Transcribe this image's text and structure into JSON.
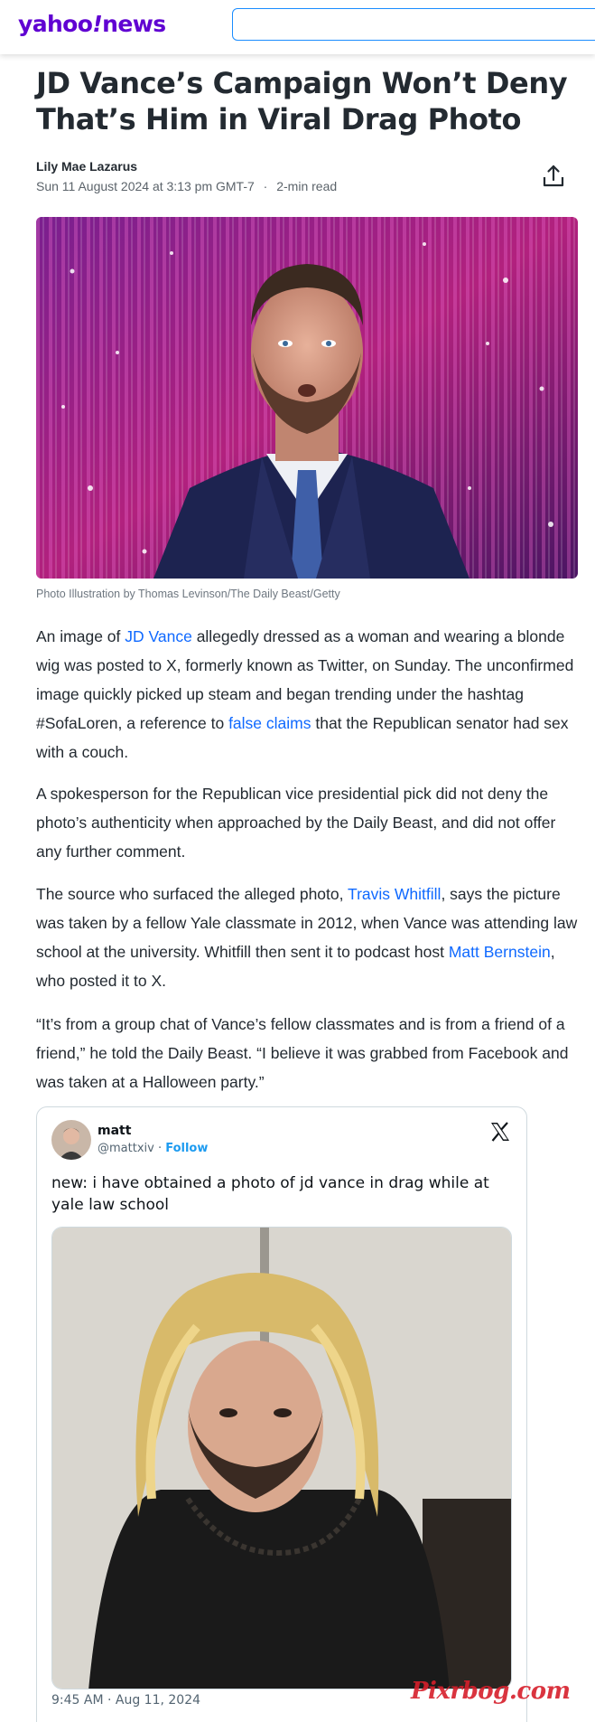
{
  "brand": {
    "logo_main": "yahoo",
    "logo_bang": "!",
    "logo_section": "news",
    "accent": "#6001d2",
    "link_color": "#0f69ff"
  },
  "search": {
    "placeholder": ""
  },
  "article": {
    "headline": "JD Vance’s Campaign Won’t Deny That’s Him in Viral Drag Photo",
    "author": "Lily Mae Lazarus",
    "date": "Sun 11 August 2024 at 3:13 pm GMT-7",
    "separator": "·",
    "read_time": "2-min read",
    "hero_caption": "Photo Illustration by Thomas Levinson/The Daily Beast/Getty",
    "p1": {
      "t1": "An image of ",
      "link1": "JD Vance",
      "t2": " allegedly dressed as a woman and wearing a blonde wig was posted to X, formerly known as Twitter, on Sunday. The unconfirmed image quickly picked up steam and began trending under the hashtag #SofaLoren, a reference to ",
      "link2": "false claims",
      "t3": " that the Republican senator had sex with a couch."
    },
    "p2": "A spokesperson for the Republican vice presidential pick did not deny the photo’s authenticity when approached by the Daily Beast, and did not offer any further comment.",
    "p3": {
      "t1": "The source who surfaced the alleged photo, ",
      "link1": "Travis Whitfill",
      "t2": ", says the picture was taken by a fellow Yale classmate in 2012, when Vance was attending law school at the university. Whitfill then sent it to podcast host ",
      "link2": "Matt Bernstein",
      "t3": ", who posted it to X."
    },
    "p4": "“It’s from a group chat of Vance’s fellow classmates and is from a friend of a friend,” he told the Daily Beast. “I believe it was grabbed from Facebook and was taken at a Halloween party.”"
  },
  "tweet": {
    "name": "matt",
    "handle": "@mattxiv",
    "dot": " · ",
    "follow": "Follow",
    "text": "new: i have obtained a photo of jd vance in drag while at yale law school",
    "timestamp": "9:45 AM · Aug 11, 2024"
  },
  "watermark": "Pixrbog.com",
  "icons": {
    "share": "share-icon",
    "x_logo": "x-logo-icon"
  }
}
